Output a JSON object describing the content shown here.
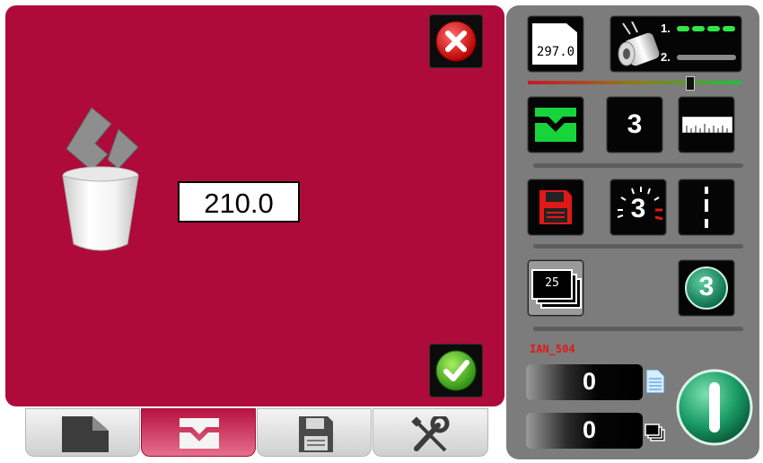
{
  "dialog": {
    "value": "210.0"
  },
  "tabs": [
    {
      "name": "page-tab"
    },
    {
      "name": "offset-tab"
    },
    {
      "name": "save-tab"
    },
    {
      "name": "tools-tab"
    }
  ],
  "right_panel": {
    "page_length": "297.0",
    "roller_line_1": "1.",
    "roller_line_2": "2.",
    "counter_badge": "3",
    "count_button": "3",
    "stack_count": "25",
    "numbered_button": "3",
    "job_name": "IAN_504",
    "counters": {
      "pages": "0",
      "stacks": "0"
    }
  },
  "colors": {
    "panel_red": "#ae0b3a",
    "accent_green": "#16c43a",
    "job_red": "#e01818"
  },
  "icons": {
    "close": "close-x-icon",
    "confirm": "checkmark-icon",
    "trash": "trash-bin-icon",
    "floppy": "floppy-disk-icon",
    "start": "power-start-icon"
  }
}
